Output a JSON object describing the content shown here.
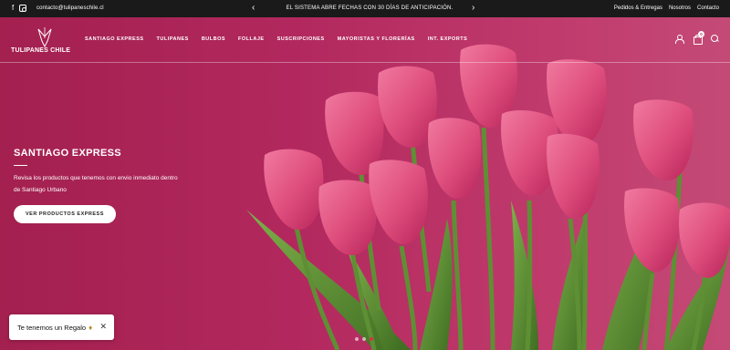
{
  "topbar": {
    "social": [
      "facebook-icon",
      "instagram-icon"
    ],
    "email": "contacto@tulipaneschile.cl",
    "announcement": "EL SISTEMA ABRE FECHAS CON 30 DÍAS DE ANTICIPACIÓN.",
    "links": [
      "Pedidos & Entregas",
      "Nosotros",
      "Contacto"
    ]
  },
  "logo": {
    "text": "TULIPANES CHILE"
  },
  "nav": [
    "SANTIAGO EXPRESS",
    "TULIPANES",
    "BULBOS",
    "FOLLAJE",
    "SUSCRIPCIONES",
    "MAYORISTAS Y FLORERÍAS",
    "INT. EXPORTS"
  ],
  "header_icons": {
    "cart_count": "0"
  },
  "hero": {
    "title": "SANTIAGO EXPRESS",
    "description": "Revisa los productos que tenemos con envio inmediato dentro de Santiago Urbano",
    "button": "VER PRODUCTOS EXPRESS"
  },
  "slider": {
    "dots": 3,
    "active": 3
  },
  "gift_popup": {
    "text": "Te tenemos un Regalo",
    "close": "✕"
  },
  "colors": {
    "accent": "#b5285f",
    "topbar": "#1a1a1a"
  }
}
